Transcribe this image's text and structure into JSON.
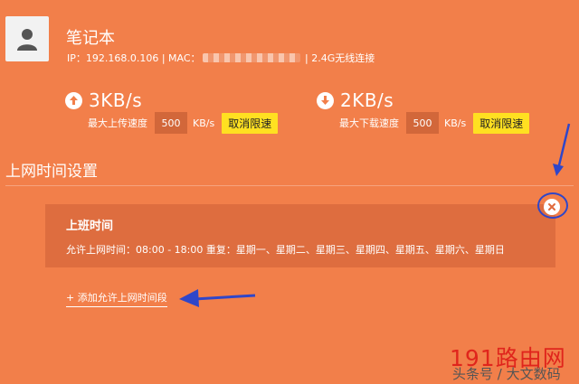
{
  "device": {
    "name": "笔记本",
    "info_prefix": "IP：192.168.0.106 | MAC：",
    "info_suffix": " | 2.4G无线连接"
  },
  "upload": {
    "value": "3KB/s",
    "label": "最大上传速度",
    "limit": "500",
    "unit": "KB/s",
    "cancel_label": "取消限速",
    "icon": "arrow-up-icon"
  },
  "download": {
    "value": "2KB/s",
    "label": "最大下载速度",
    "limit": "500",
    "unit": "KB/s",
    "cancel_label": "取消限速",
    "icon": "arrow-down-icon"
  },
  "section": {
    "title": "上网时间设置"
  },
  "rule": {
    "title": "上班时间",
    "detail": "允许上网时间：08:00 - 18:00   重复：星期一、星期二、星期三、星期四、星期五、星期六、星期日"
  },
  "add_link": "+ 添加允许上网时间段",
  "watermark": {
    "site": "191路由网",
    "caption": "头条号 / 大文数码"
  },
  "colors": {
    "background": "#f27f4a",
    "panel": "#de6d3f",
    "button": "#ffe021",
    "annotation": "#2f46c9",
    "watermark": "#e0251c"
  }
}
